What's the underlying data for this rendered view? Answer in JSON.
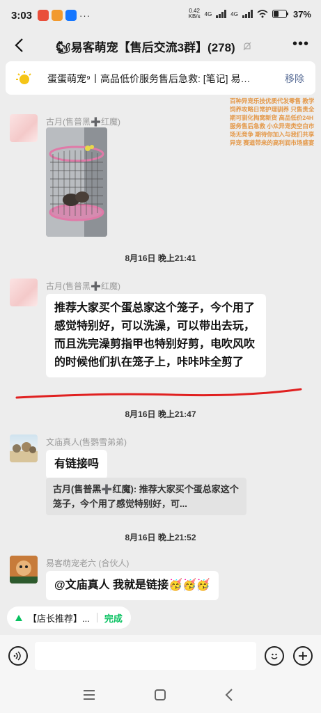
{
  "status": {
    "time": "3:03",
    "net_speed": "0.42",
    "net_unit": "KB/s",
    "net_type1": "4G",
    "net_type2": "4G",
    "battery": "37%",
    "app_colors": [
      "#e94f3b",
      "#f29a2e",
      "#1677ff"
    ]
  },
  "header": {
    "back_icon": "chevron-left-icon",
    "title": "🐿易客萌宠【售后交流3群】(278)",
    "mute_icon": "bell-off-icon",
    "more_icon": "ellipsis-icon"
  },
  "pinned": {
    "icon": "sun-speaker-icon",
    "text": "蛋蛋萌宠⁹丨高品低价服务售后急救: [笔记] 易客...",
    "remove_label": "移除"
  },
  "watermark_text": "百种异宠乐技优质代发零售 教学饲养攻略日常护理驯养 只售贵全期可驯化掏窝新货 高品低价24H服务售后急救 小众异宠类空白市场无竞争 期待你加入与我们共享异宠 赛道带来的高利润市场盛宴",
  "messages": [
    {
      "sender": "古月(售普黑➕红魔)",
      "type": "image",
      "image_desc": "cage-photo"
    },
    {
      "timestamp": "8月16日 晚上21:41"
    },
    {
      "sender": "古月(售普黑➕红魔)",
      "text": "推荐大家买个蛋总家这个笼子，今个用了感觉特别好，可以洗澡，可以带出去玩，而且洗完澡剪指甲也特别好剪，电吹风吹的时候他们扒在笼子上，咔咔咔全剪了"
    },
    {
      "timestamp": "8月16日 晚上21:47"
    },
    {
      "sender": "文庙真人(售鹦雪弟弟)",
      "text": "有链接吗",
      "quote": "古月(售普黑➕红魔): 推荐大家买个蛋总家这个笼子，今个用了感觉特别好，可..."
    },
    {
      "timestamp": "8月16日 晚上21:52"
    },
    {
      "sender": "易客萌宠老六 (合伙人)",
      "text": "@文庙真人  我就是链接🥳🥳🥳"
    }
  ],
  "shop_tag": {
    "label": "【店长推荐】...",
    "done": "完成"
  },
  "input": {
    "placeholder": ""
  },
  "colors": {
    "accent_green": "#07c160",
    "link_blue": "#576b95",
    "underline_red": "#e02020"
  }
}
